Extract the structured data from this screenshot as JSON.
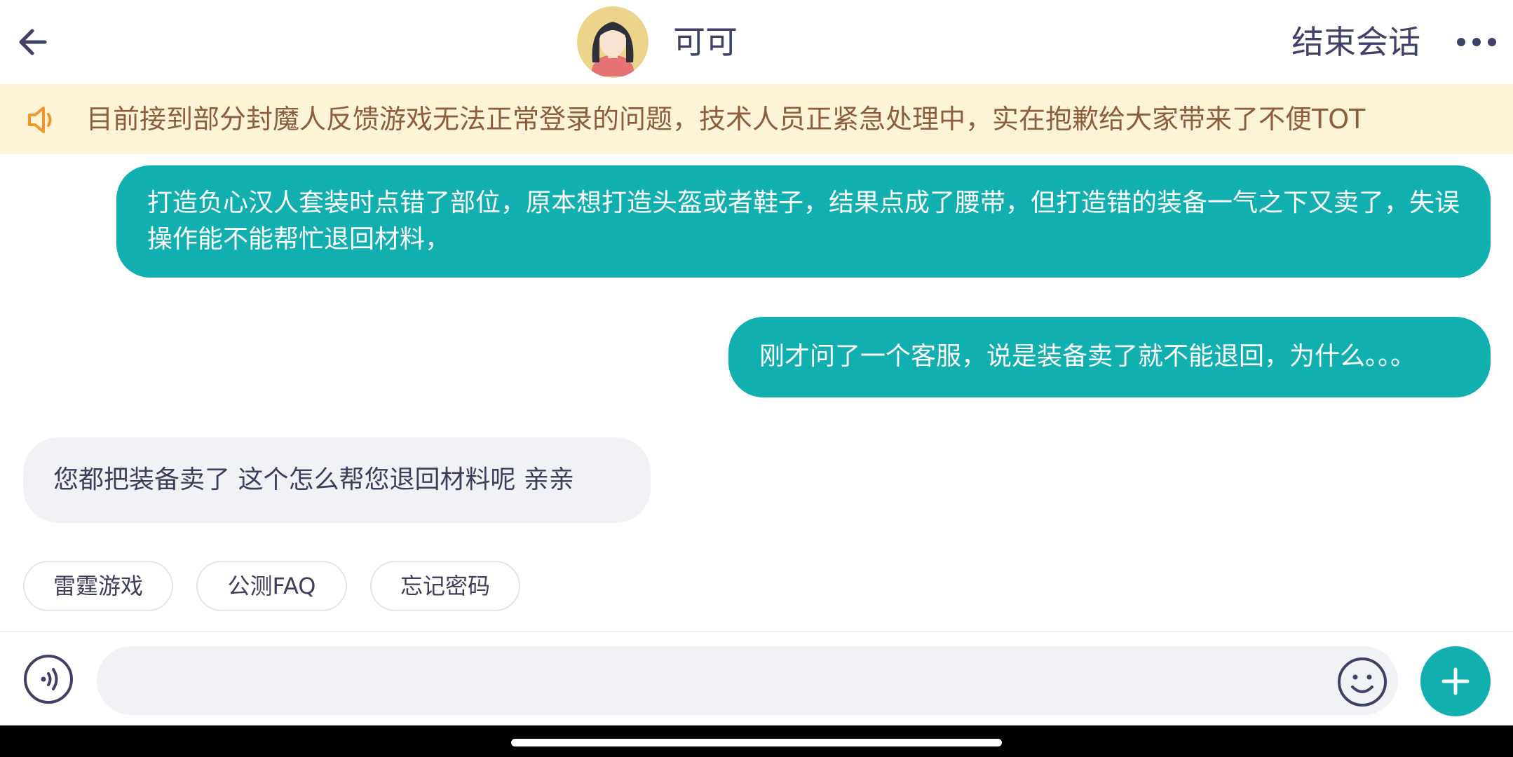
{
  "header": {
    "agent_name": "可可",
    "end_session_label": "结束会话",
    "icons": {
      "back": "arrow-left-icon",
      "more": "more-dots-icon",
      "avatar": "agent-avatar"
    }
  },
  "notice": {
    "text": "目前接到部分封魔人反馈游戏无法正常登录的问题，技术人员正紧急处理中，实在抱歉给大家带来了不便TOT",
    "icon": "speaker-icon"
  },
  "messages": [
    {
      "from": "user",
      "text": "打造负心汉人套装时点错了部位，原本想打造头盔或者鞋子，结果点成了腰带，但打造错的装备一气之下又卖了，失误操作能不能帮忙退回材料，"
    },
    {
      "from": "user",
      "text": "刚才问了一个客服，说是装备卖了就不能退回，为什么。。。"
    },
    {
      "from": "agent",
      "text": "您都把装备卖了 这个怎么帮您退回材料呢 亲亲"
    }
  ],
  "quick_replies": [
    "雷霆游戏",
    "公测FAQ",
    "忘记密码"
  ],
  "input": {
    "value": "",
    "placeholder": "",
    "icons": {
      "voice": "voice-icon",
      "emoji": "emoji-icon",
      "add": "plus-icon"
    }
  },
  "colors": {
    "accent": "#12afb0",
    "notice_bg": "#fdf4d7",
    "notice_text": "#8c5e3c",
    "agent_bubble": "#f0f2f6"
  }
}
